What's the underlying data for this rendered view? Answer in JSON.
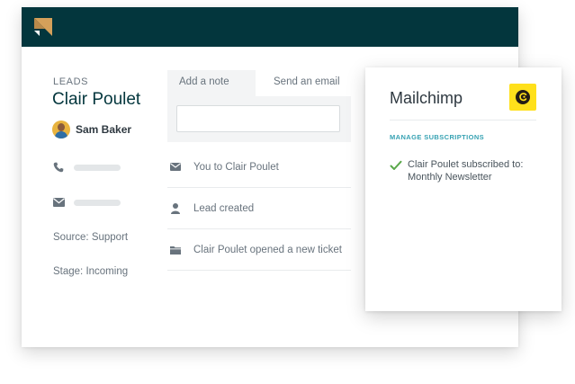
{
  "leads": {
    "section_label": "LEADS",
    "name": "Clair Poulet",
    "owner": "Sam Baker",
    "source": "Source: Support",
    "stage": "Stage: Incoming"
  },
  "composer": {
    "tabs": [
      {
        "label": "Add a note",
        "active": false
      },
      {
        "label": "Send an email",
        "active": true
      }
    ],
    "note_value": ""
  },
  "timeline": [
    {
      "icon": "envelope-icon",
      "text": "You to Clair Poulet"
    },
    {
      "icon": "person-icon",
      "text": "Lead created"
    },
    {
      "icon": "folder-icon",
      "text": "Clair Poulet opened a new ticket"
    }
  ],
  "mailchimp": {
    "title": "Mailchimp",
    "manage_label": "MANAGE SUBSCRIPTIONS",
    "subscription_line1": "Clair Poulet subscribed to:",
    "subscription_line2": "Monthly Newsletter"
  },
  "colors": {
    "topbar": "#03363d",
    "accent_gold": "#d4a05a",
    "mailchimp_yellow": "#ffe01b",
    "link_teal": "#37a2b3",
    "check_green": "#5aa84a"
  }
}
